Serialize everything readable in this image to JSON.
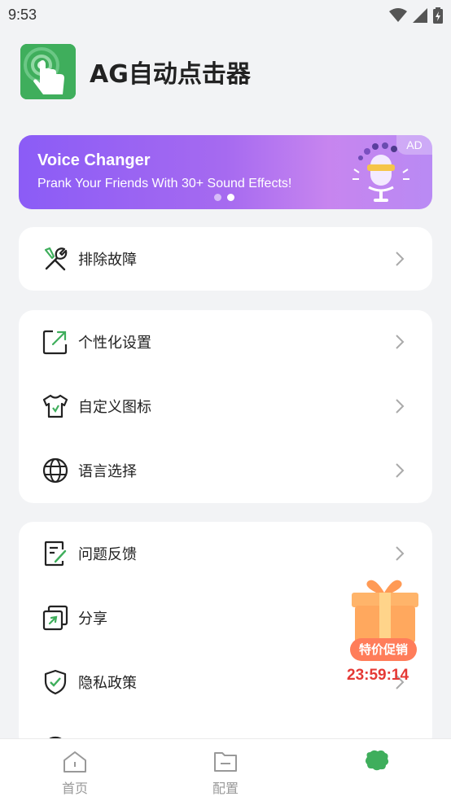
{
  "status_bar": {
    "time": "9:53",
    "icons": [
      "wifi-icon",
      "signal-icon",
      "battery-charging-icon"
    ]
  },
  "app": {
    "title": "AG自动点击器",
    "logo_icon": "tap-hand-icon",
    "brand_color": "#3fae5c"
  },
  "ad_banner": {
    "title": "Voice Changer",
    "subtitle": "Prank Your Friends With 30+ Sound Effects!",
    "badge": "AD",
    "page_count": 2,
    "active_page": 2
  },
  "menu_groups": [
    {
      "items": [
        {
          "label": "排除故障",
          "icon": "wrench-screwdriver-icon"
        }
      ]
    },
    {
      "items": [
        {
          "label": "个性化设置",
          "icon": "personalize-icon"
        },
        {
          "label": "自定义图标",
          "icon": "shirt-icon"
        },
        {
          "label": "语言选择",
          "icon": "globe-icon"
        }
      ]
    },
    {
      "items": [
        {
          "label": "问题反馈",
          "icon": "feedback-icon"
        },
        {
          "label": "分享",
          "icon": "share-icon"
        },
        {
          "label": "隐私政策",
          "icon": "shield-check-icon"
        }
      ]
    }
  ],
  "promo": {
    "tag": "特价促销",
    "timer": "23:59:14",
    "icon": "gift-box-icon"
  },
  "tab_bar": {
    "tabs": [
      {
        "label": "首页",
        "icon": "home-icon"
      },
      {
        "label": "配置",
        "icon": "folder-icon"
      },
      {
        "label": "",
        "icon": "app-logo-icon",
        "active": true
      }
    ]
  },
  "colors": {
    "accent": "#3fae5c",
    "background": "#f2f3f5",
    "promo": "#ff7d5a",
    "timer": "#e53935"
  }
}
